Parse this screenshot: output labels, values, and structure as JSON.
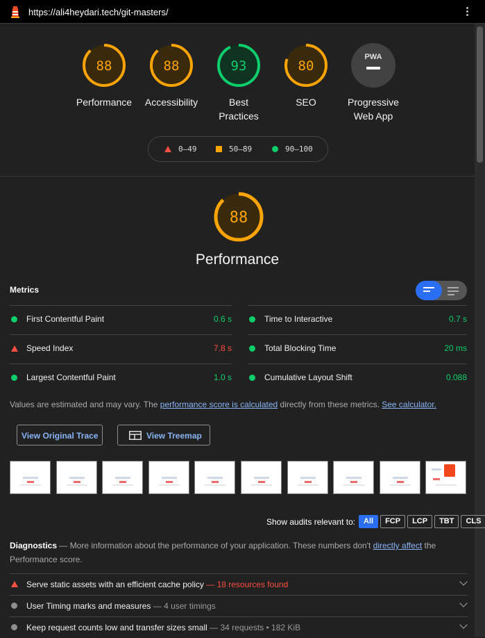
{
  "browser": {
    "url": "https://ali4heydari.tech/git-masters/"
  },
  "colors": {
    "pass": "#0cce6b",
    "average": "#ffa400",
    "fail": "#ff4e42",
    "link": "#8ab4f8",
    "accent": "#2a6ef4"
  },
  "summary": {
    "gauges": [
      {
        "score": "88",
        "label": "Performance",
        "status": "average"
      },
      {
        "score": "88",
        "label": "Accessibility",
        "status": "average"
      },
      {
        "score": "93",
        "label": "Best Practices",
        "status": "pass"
      },
      {
        "score": "80",
        "label": "SEO",
        "status": "average"
      },
      {
        "badge": "PWA",
        "label": "Progressive Web App",
        "status": "na"
      }
    ],
    "legend": {
      "fail": "0–49",
      "average": "50–89",
      "pass": "90–100"
    }
  },
  "performance": {
    "score": "88",
    "title": "Performance",
    "metrics_heading": "Metrics",
    "metrics": [
      {
        "name": "First Contentful Paint",
        "value": "0.6 s",
        "status": "pass"
      },
      {
        "name": "Time to Interactive",
        "value": "0.7 s",
        "status": "pass"
      },
      {
        "name": "Speed Index",
        "value": "7.8 s",
        "status": "fail"
      },
      {
        "name": "Total Blocking Time",
        "value": "20 ms",
        "status": "pass"
      },
      {
        "name": "Largest Contentful Paint",
        "value": "1.0 s",
        "status": "pass"
      },
      {
        "name": "Cumulative Layout Shift",
        "value": "0.088",
        "status": "pass"
      }
    ],
    "note": {
      "prefix": "Values are estimated and may vary. The ",
      "link1": "performance score is calculated",
      "middle": " directly from these metrics. ",
      "link2": "See calculator."
    },
    "buttons": {
      "trace": "View Original Trace",
      "treemap": "View Treemap"
    },
    "filmstrip_count": 10,
    "filter": {
      "label": "Show audits relevant to:",
      "chips": [
        "All",
        "FCP",
        "LCP",
        "TBT",
        "CLS"
      ],
      "active": "All"
    },
    "diagnostics": {
      "title": "Diagnostics",
      "dash": " — ",
      "desc": "More information about the performance of your application. These numbers don't ",
      "link": "directly affect",
      "desc2": " the Performance score."
    },
    "audits": [
      {
        "title": "Serve static assets with an efficient cache policy",
        "detail": "18 resources found",
        "status": "fail"
      },
      {
        "title": "User Timing marks and measures",
        "detail": "4 user timings",
        "status": "info"
      },
      {
        "title": "Keep request counts low and transfer sizes small",
        "detail": "34 requests • 182 KiB",
        "status": "info"
      }
    ]
  }
}
